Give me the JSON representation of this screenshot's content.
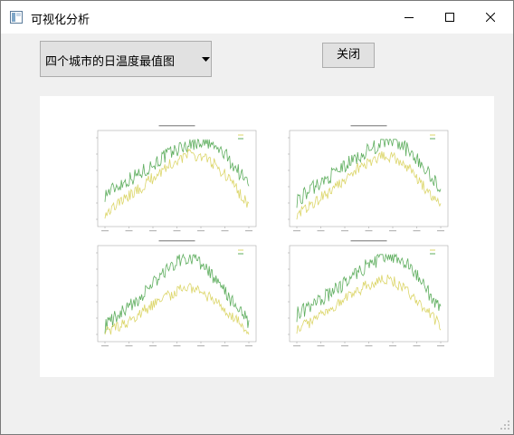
{
  "window": {
    "title": "可视化分析",
    "icon": "window-app-icon"
  },
  "controls": {
    "minimize": "minimize-icon",
    "maximize": "maximize-icon",
    "close": "close-icon"
  },
  "selector": {
    "value": "四个城市的日温度最值图"
  },
  "close_button": {
    "label": "关闭"
  },
  "colors": {
    "high": "#5fae5f",
    "low": "#dcd66a",
    "window_bg": "#f0f0f0"
  },
  "chart_data": [
    {
      "type": "line",
      "title": "",
      "series": [
        {
          "values": [
            0.32,
            0.42,
            0.5,
            0.58,
            0.68,
            0.78,
            0.86,
            0.92,
            0.96,
            0.9,
            0.8,
            0.62,
            0.44
          ]
        },
        {
          "values": [
            0.1,
            0.2,
            0.3,
            0.4,
            0.52,
            0.64,
            0.73,
            0.8,
            0.78,
            0.7,
            0.56,
            0.38,
            0.18
          ]
        }
      ]
    },
    {
      "type": "line",
      "title": "",
      "series": [
        {
          "values": [
            0.25,
            0.36,
            0.46,
            0.56,
            0.66,
            0.76,
            0.85,
            0.93,
            0.96,
            0.88,
            0.76,
            0.56,
            0.38
          ]
        },
        {
          "values": [
            0.08,
            0.18,
            0.28,
            0.38,
            0.5,
            0.62,
            0.71,
            0.78,
            0.76,
            0.68,
            0.52,
            0.34,
            0.16
          ]
        }
      ]
    },
    {
      "type": "line",
      "title": "",
      "series": [
        {
          "values": [
            0.12,
            0.24,
            0.34,
            0.48,
            0.62,
            0.78,
            0.9,
            0.96,
            0.88,
            0.7,
            0.54,
            0.34,
            0.16
          ]
        },
        {
          "values": [
            0.04,
            0.1,
            0.18,
            0.28,
            0.38,
            0.46,
            0.54,
            0.58,
            0.54,
            0.44,
            0.32,
            0.18,
            0.06
          ]
        }
      ]
    },
    {
      "type": "line",
      "title": "",
      "series": [
        {
          "values": [
            0.26,
            0.34,
            0.44,
            0.54,
            0.64,
            0.76,
            0.86,
            0.94,
            0.96,
            0.88,
            0.74,
            0.52,
            0.3
          ]
        },
        {
          "values": [
            0.1,
            0.16,
            0.24,
            0.34,
            0.44,
            0.54,
            0.62,
            0.68,
            0.66,
            0.56,
            0.44,
            0.28,
            0.12
          ]
        }
      ]
    }
  ]
}
